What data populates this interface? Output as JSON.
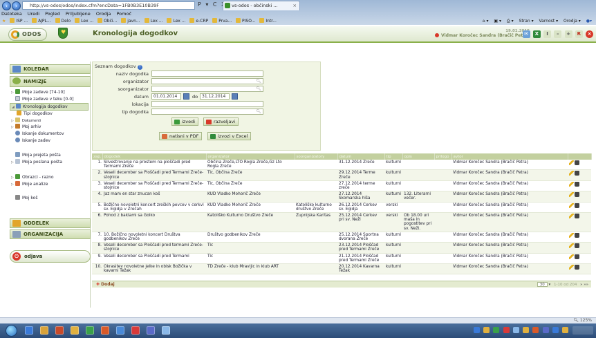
{
  "browser": {
    "url": "http://vs-odos/odos/index.cfm?encData=1FB0B3E10B39F",
    "addr_controls": "P ▾ C X",
    "tabs": [
      {
        "label": "vs-odos - občinski ..."
      }
    ],
    "menu": [
      "Datoteka",
      "Uredi",
      "Pogled",
      "Priljubljene",
      "Orodja",
      "Pomoč"
    ],
    "favorites": [
      "ISP ...",
      "AJPL...",
      "Delo",
      "Lex ...",
      "Obči...",
      "javn...",
      "Lex ...",
      "Lex ...",
      "e-CRP",
      "Prva...",
      "PISO...",
      "Intr..."
    ],
    "commands": [
      "Stran ▾",
      "Varnost ▾",
      "Orodja ▾"
    ],
    "status_zoom": "125%"
  },
  "app": {
    "logo_text": "ODOS",
    "page_title": "Kronologija dogodkov",
    "user_date": "19.01.2015",
    "user_name": "Vidmar Koročec Sandra (Bračič Petra)",
    "header_icons": {
      "info": "I",
      "minus": "–",
      "plus": "+",
      "r": "R"
    }
  },
  "sidebar": {
    "sections": {
      "koledar": "KOLEDAR",
      "namizje": "NAMIZJE",
      "oddelek": "ODDELEK",
      "organizacija": "ORGANIZACIJA"
    },
    "items": [
      {
        "label": "Moje zadeve [74-10]",
        "icon": "folder-icon"
      },
      {
        "label": "Moje zadeve v teku [0-0]",
        "icon": "page-icon"
      },
      {
        "label": "Kronologija dogodkov",
        "icon": "calendar-icon"
      },
      {
        "label": "Tipi dogodkov",
        "icon": "list-icon"
      },
      {
        "label": "Dokumenti",
        "icon": "folder-icon"
      },
      {
        "label": "Moj arhiv",
        "icon": "archive-icon"
      },
      {
        "label": "Iskanje dokumentov",
        "icon": "search-icon"
      },
      {
        "label": "Iskanje zadev",
        "icon": "search-icon"
      },
      {
        "label": "Moja prejeta pošta",
        "icon": "inbox-icon"
      },
      {
        "label": "Moja poslana pošta",
        "icon": "outbox-icon"
      },
      {
        "label": "Obrazci - razno",
        "icon": "form-icon"
      },
      {
        "label": "Moje analize",
        "icon": "chart-icon"
      },
      {
        "label": "Moj koš",
        "icon": "trash-icon"
      }
    ],
    "logout": "odjava"
  },
  "search_form": {
    "title": "Seznam dogodkov",
    "fields": {
      "naziv_label": "naziv dogodka",
      "naziv_value": "",
      "organizator_label": "organizator",
      "organizator_value": "",
      "soorganizator_label": "soorganizator",
      "soorganizator_value": "",
      "datum_label": "datum",
      "datum_from": "01.01.2014",
      "datum_to_label": "do",
      "datum_to": "31.12.2014",
      "lokacija_label": "lokacija",
      "lokacija_value": "",
      "tip_label": "tip dogodka",
      "tip_value": ""
    },
    "buttons": {
      "execute": "izvedi",
      "reset": "razveljavi",
      "print_pdf": "natisni v PDF",
      "export_excel": "izvozi v Excel"
    }
  },
  "table": {
    "columns": [
      "zap. št.",
      "dogodek",
      "organizator",
      "soorganizatory",
      "datum",
      "lokacija",
      "tip",
      "opis",
      "prilogo",
      "avtor",
      ""
    ],
    "rows": [
      {
        "n": "1.",
        "event": "Silvestrovanje na prostem na ploščadi pred Termami Zreče",
        "org": "Občina Zreče,LTO Rogla Zreče,Gz Lto Rogla Zreče",
        "coorg": "",
        "date": "31.12.2014",
        "loc": "Zreče",
        "type": "kulturni",
        "desc": "",
        "author": "Vidmar Koročec Sandra (Bračič Petra)"
      },
      {
        "n": "2.",
        "event": "Veseli december sa Ploščadi pred Termami Zreče-stojnice",
        "org": "Tic, Občina Zreče",
        "coorg": "",
        "date": "29.12.2014",
        "loc": "Terme Zreče",
        "type": "kulturni",
        "desc": "",
        "author": "Vidmar Koročec Sandra (Bračič Petra)"
      },
      {
        "n": "3.",
        "event": "Veseli december sa Ploščadi pred Termami Zreče-stojnice",
        "org": "Tic, Občina Zreče",
        "coorg": "",
        "date": "27.12.2014",
        "loc": "terme zreče",
        "type": "kulturni",
        "desc": "",
        "author": "Vidmar Koročec Sandra (Bračič Petra)"
      },
      {
        "n": "4.",
        "event": "Jaz mam en star znucan koš",
        "org": "KUD Vladko Mohorič Zreče",
        "coorg": "",
        "date": "27.12.2014",
        "loc": "Skomarska hiša",
        "type": "kulturni",
        "desc": "132. Literarni večer.",
        "author": "Vidmar Koročec Sandra (Bračič Petra)"
      },
      {
        "n": "5.",
        "event": "Božično novoletni koncert zreških pevcev v cerkvi sv. Egidja v Zrečah",
        "org": "KUD Vladko Mohorič Zreče",
        "coorg": "Katoliško kulturno društvo Zreče",
        "date": "26.12.2014",
        "loc": "Cerkev sv. Egidja",
        "type": "verski",
        "desc": "",
        "author": "Vidmar Koročec Sandra (Bračič Petra)"
      },
      {
        "n": "6.",
        "event": "Pohod z baklami sa Golko",
        "org": "Katoliško Kulturno Društvo Zreče",
        "coorg": "Župnijska Karitas",
        "date": "25.12.2014",
        "loc": "Cerkev pri sv. Neži",
        "type": "verski",
        "desc": "Ob 18.00 uri maša in pogostitev pri sv. Neži.",
        "author": "Vidmar Koročec Sandra (Bračič Petra)"
      },
      {
        "n": "7.",
        "event": "10. Božično novoletni koncert Društva godbenikov Zreče",
        "org": "Društvo godbenikov Zreče",
        "coorg": "",
        "date": "25.12.2014",
        "loc": "Športna dvorana Zreče",
        "type": "kulturni",
        "desc": "",
        "author": "Vidmar Koročec Sandra (Bračič Petra)"
      },
      {
        "n": "8.",
        "event": "Veseli december sa Ploščadi pred termami Zreče-stojnice",
        "org": "Tic",
        "coorg": "",
        "date": "23.12.2014",
        "loc": "Ploščad pred Termami Zreče",
        "type": "kulturni",
        "desc": "",
        "author": "Vidmar Koročec Sandra (Bračič Petra)"
      },
      {
        "n": "9.",
        "event": "Veseli december sa Ploščadi pred Termami",
        "org": "Tic",
        "coorg": "",
        "date": "21.12.2014",
        "loc": "Ploščad pred Termami Zreče",
        "type": "kulturni",
        "desc": "",
        "author": "Vidmar Koročec Sandra (Bračič Petra)"
      },
      {
        "n": "10.",
        "event": "Okrasitev novoletne jelke in obisk Božička v kavarni Težak",
        "org": "TD Zreče - klub Mravljic in klub ART",
        "coorg": "",
        "date": "20.12.2014",
        "loc": "Kavarna Težak",
        "type": "kulturni",
        "desc": "",
        "author": "Vidmar Koročec Sandra (Bračič Petra)"
      }
    ],
    "add_label": "Dodaj",
    "pager": {
      "page_size": "30",
      "info": "1-10 od 204",
      "next": "»",
      "last": "»»"
    }
  }
}
